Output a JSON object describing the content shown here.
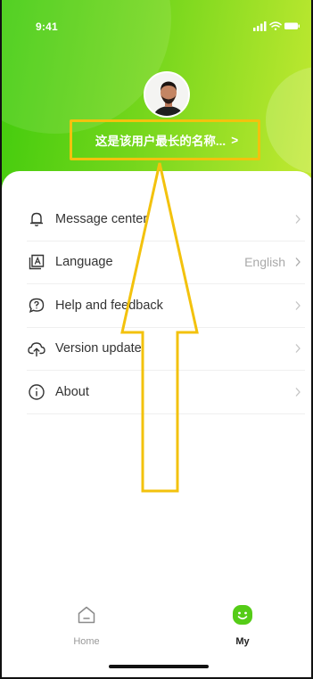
{
  "status_bar": {
    "time": "9:41"
  },
  "profile": {
    "username": "这是该用户最长的名称...",
    "username_chevron": ">"
  },
  "menu": [
    {
      "label": "Message center",
      "icon": "bell-icon"
    },
    {
      "label": "Language",
      "icon": "translate-icon",
      "value": "English"
    },
    {
      "label": "Help and feedback",
      "icon": "help-icon"
    },
    {
      "label": "Version update",
      "icon": "cloud-upload-icon"
    },
    {
      "label": "About",
      "icon": "info-icon"
    }
  ],
  "tabbar": {
    "tabs": [
      {
        "label": "Home",
        "icon": "home-icon",
        "active": false
      },
      {
        "label": "My",
        "icon": "smiley-icon",
        "active": true
      }
    ]
  },
  "colors": {
    "brand_green": "#3fcb0c",
    "gradient_end": "#c6ea32",
    "annotation_yellow": "#f3c20d",
    "active_tab_icon": "#55cc17"
  }
}
